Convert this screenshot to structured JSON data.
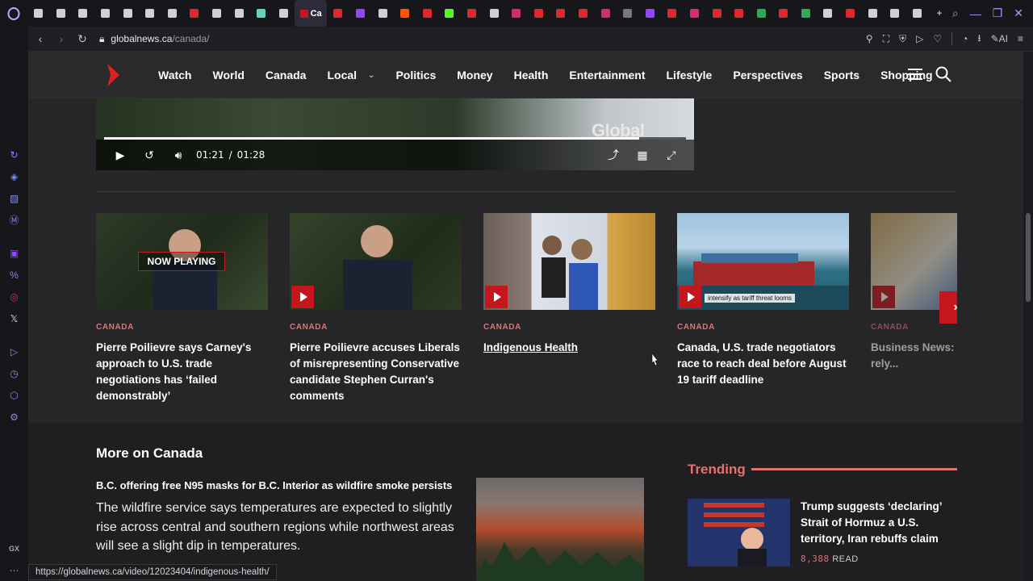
{
  "browser": {
    "tab_count": 40,
    "tab_colors": [
      "#cfcfd6",
      "#cfcfd6",
      "#cfcfd6",
      "#cfcfd6",
      "#cfcfd6",
      "#cfcfd6",
      "#cfcfd6",
      "#e0272e",
      "#cfcfd6",
      "#cfcfd6",
      "#6ad3c0",
      "#cfcfd6",
      "#c4161c",
      "#e0272e",
      "#9146ff",
      "#cfcfd6",
      "#ff5700",
      "#e0272e",
      "#53fc18",
      "#e0272e",
      "#cfcfd6",
      "#d62976",
      "#e0272e",
      "#e0272e",
      "#e0272e",
      "#d62976",
      "#777",
      "#9146ff",
      "#e0272e",
      "#d62976",
      "#e0272e",
      "#e0272e",
      "#34a853",
      "#e0272e",
      "#34a853",
      "#cfcfd6",
      "#e0272e",
      "#cfcfd6",
      "#cfcfd6",
      "#cfcfd6"
    ],
    "active_tab_label": "Ca",
    "url_host": "globalnews.ca",
    "url_path": "/canada/",
    "ai_label": "AI",
    "sidebar_label": "GX",
    "status_url": "https://globalnews.ca/video/12023404/indigenous-health/"
  },
  "site": {
    "nav": [
      {
        "label": "Watch"
      },
      {
        "label": "World"
      },
      {
        "label": "Canada"
      },
      {
        "label": "Local",
        "dropdown": true
      },
      {
        "label": "Politics"
      },
      {
        "label": "Money"
      },
      {
        "label": "Health"
      },
      {
        "label": "Entertainment"
      },
      {
        "label": "Lifestyle"
      },
      {
        "label": "Perspectives"
      },
      {
        "label": "Sports"
      },
      {
        "label": "Shopping"
      }
    ],
    "brand_color": "#c4161c"
  },
  "video": {
    "current_time": "01:21",
    "separator": "/",
    "duration": "01:28",
    "progress_fraction": 0.92,
    "watermark": "Global"
  },
  "carousel": {
    "cards": [
      {
        "category": "CANADA",
        "headline": "Pierre Poilievre says Carney's approach to U.S. trade negotiations has ‘failed demonstrably’",
        "now_playing": "NOW PLAYING"
      },
      {
        "category": "CANADA",
        "headline": "Pierre Poilievre accuses Liberals of misrepresenting Conservative candidate Stephen Curran's comments"
      },
      {
        "category": "CANADA",
        "headline": "Indigenous Health",
        "hovered": true
      },
      {
        "category": "CANADA",
        "headline": "Canada, U.S. trade negotiators race to reach deal before August 19 tariff deadline",
        "thumb_caption": "intensify as tariff threat looms"
      },
      {
        "category": "CANADA",
        "headline": "Business News: ... increasingly rely..."
      }
    ]
  },
  "more": {
    "title": "More on Canada",
    "story_title": "B.C. offering free N95 masks for B.C. Interior as wildfire smoke persists",
    "story_body": "The wildfire service says temperatures are expected to slightly rise across central and southern regions while northwest areas will see a slight dip in temperatures."
  },
  "trending": {
    "title": "Trending",
    "headline": "Trump suggests ‘declaring’ Strait of Hormuz a U.S. territory, Iran rebuffs claim",
    "reads": "8,388",
    "reads_label": "READ"
  }
}
